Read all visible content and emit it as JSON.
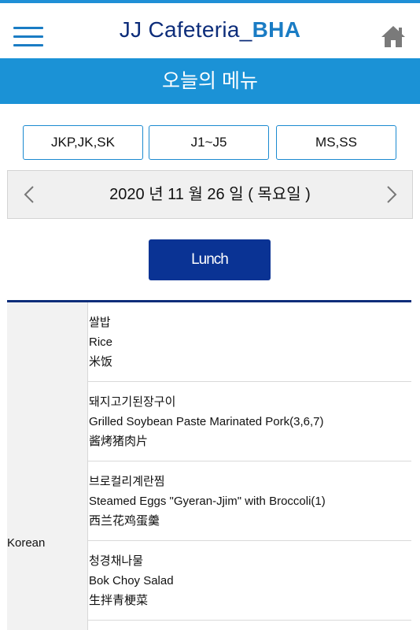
{
  "header": {
    "brand_main": "JJ Cafeteria_",
    "brand_accent": "BHA"
  },
  "banner": {
    "title": "오늘의 메뉴"
  },
  "tabs": [
    {
      "label": "JKP,JK,SK"
    },
    {
      "label": "J1~J5"
    },
    {
      "label": "MS,SS"
    }
  ],
  "date": {
    "text": "2020 년 11 월 26 일 ( 목요일 )"
  },
  "meal": {
    "label": "Lunch"
  },
  "menu": {
    "category": "Korean",
    "items": [
      {
        "ko": "쌀밥",
        "en": "Rice",
        "zh": "米饭"
      },
      {
        "ko": "돼지고기된장구이",
        "en": "Grilled Soybean Paste Marinated Pork(3,6,7)",
        "zh": "酱烤猪肉片"
      },
      {
        "ko": "브로컬리계란찜",
        "en": "Steamed Eggs \"Gyeran-Jjim\" with Broccoli(1)",
        "zh": "西兰花鸡蛋羹"
      },
      {
        "ko": "청경채나물",
        "en": "Bok Choy Salad",
        "zh": "生拌青梗菜"
      }
    ]
  },
  "colors": {
    "accent": "#1b92d6",
    "brand_dark": "#0d2d7a",
    "button": "#0a3394"
  },
  "icons": {
    "menu": "hamburger-icon",
    "home": "home-icon",
    "prev": "chevron-left-icon",
    "next": "chevron-right-icon"
  }
}
